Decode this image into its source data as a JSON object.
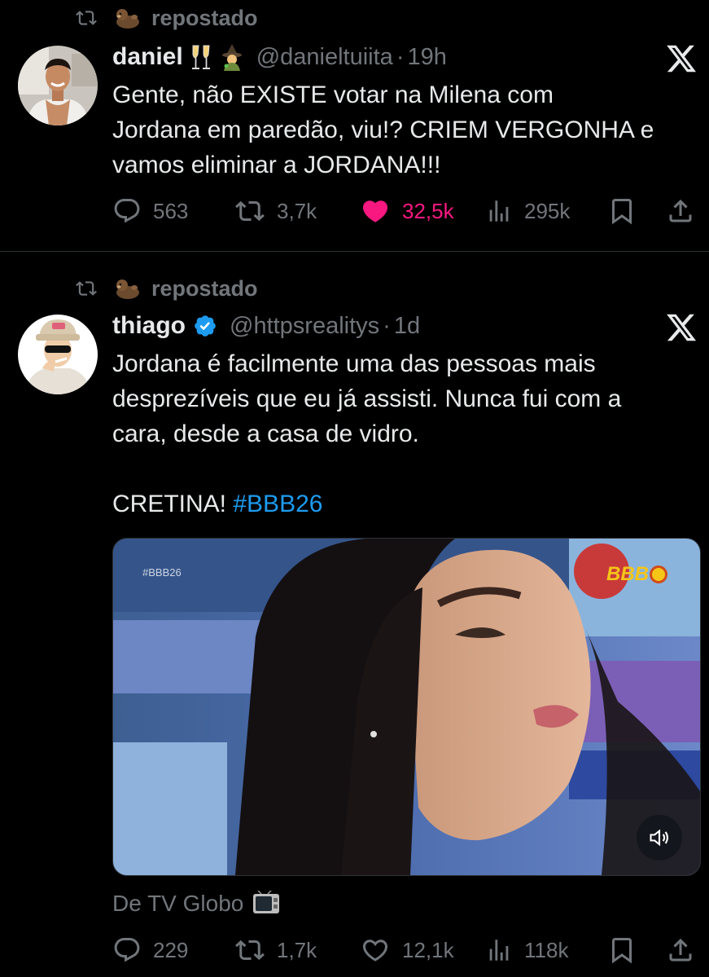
{
  "tweets": [
    {
      "repost_label": "repostado",
      "display_name": "daniel",
      "name_emojis": [
        "🥂",
        "🧙‍♀️"
      ],
      "handle": "@danieltuiita",
      "separator": "·",
      "time": "19h",
      "text": "Gente, não EXISTE votar na Milena com\nJordana em paredão, viu!? CRIEM VERGONHA e\nvamos eliminar a JORDANA!!!",
      "replies": "563",
      "reposts": "3,7k",
      "likes": "32,5k",
      "views": "295k",
      "liked": true
    },
    {
      "repost_label": "repostado",
      "display_name": "thiago",
      "verified": true,
      "handle": "@httpsrealitys",
      "separator": "·",
      "time": "1d",
      "text": "Jordana é facilmente uma das pessoas mais\ndesprezíveis que eu já assisti. Nunca fui com a\ncara, desde a casa de vidro.\n\nCRETINA! ",
      "hashtag": "#BBB26",
      "media": {
        "watermark_left": "#BBB26",
        "watermark_right": "BBB"
      },
      "media_source": "De TV Globo",
      "media_source_emoji": "📺",
      "replies": "229",
      "reposts": "1,7k",
      "likes": "12,1k",
      "views": "118k",
      "liked": false
    }
  ],
  "colors": {
    "background": "#000000",
    "text": "#e7e9ea",
    "muted": "#71767b",
    "like": "#f91880",
    "link": "#1d9bf0",
    "verified": "#1d9bf0",
    "divider": "#2f3336"
  }
}
